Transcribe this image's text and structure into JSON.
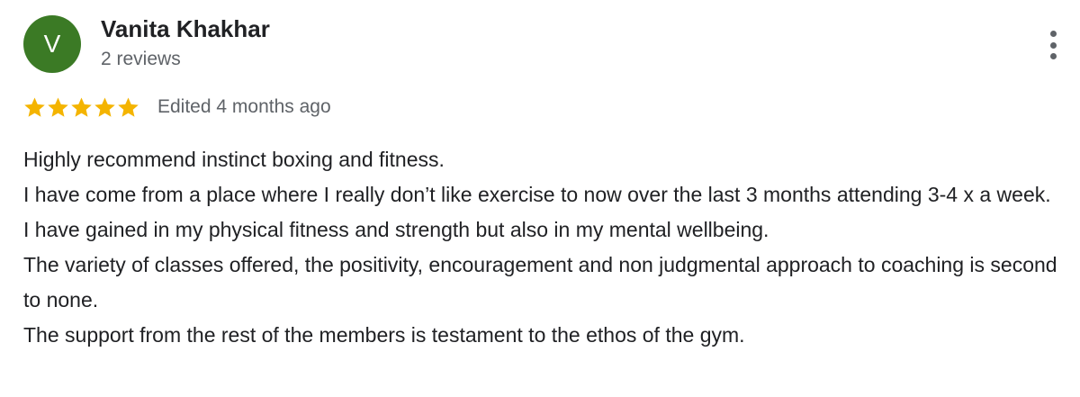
{
  "reviewer": {
    "initial": "V",
    "name": "Vanita Khakhar",
    "reviews_count": "2 reviews",
    "avatar_color": "#3b7a25"
  },
  "rating": {
    "stars": 5,
    "max": 5,
    "star_color": "#f4b400",
    "edited": "Edited 4 months ago"
  },
  "menu": {
    "icon": "more-vert-icon"
  },
  "review_text": [
    "Highly recommend instinct boxing and fitness.",
    "I have come from a place where I really don’t like exercise to now over the last 3 months attending 3-4 x a week.",
    "I have gained in my physical fitness and strength but also in my mental wellbeing.",
    "The variety of classes offered, the positivity, encouragement and non judgmental approach to coaching is second to none.",
    "The support from the rest of the members is testament to the ethos of the gym."
  ]
}
